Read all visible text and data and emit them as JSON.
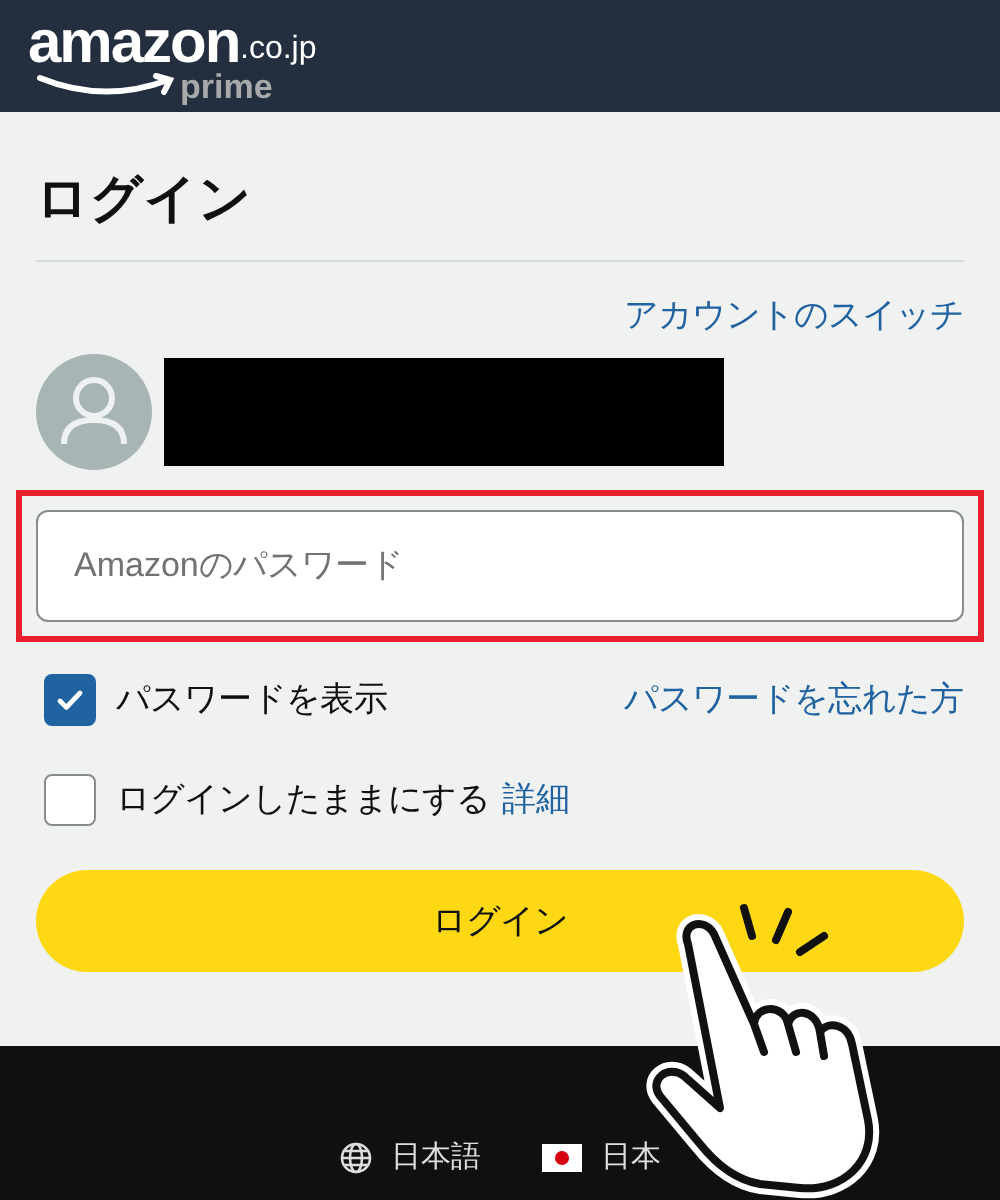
{
  "header": {
    "logo": {
      "wordmark": "amazon",
      "domain": ".co.jp",
      "sub": "prime"
    }
  },
  "title": "ログイン",
  "switch_account_link": "アカウントのスイッチ",
  "password_field": {
    "placeholder": "Amazonのパスワード",
    "highlighted": true
  },
  "show_password": {
    "label": "パスワードを表示",
    "checked": true
  },
  "forgot_password_link": "パスワードを忘れた方",
  "keep_signed_in": {
    "label": "ログインしたままにする",
    "checked": false,
    "details_link": "詳細"
  },
  "login_button": "ログイン",
  "footer": {
    "language": "日本語",
    "country": "日本"
  }
}
